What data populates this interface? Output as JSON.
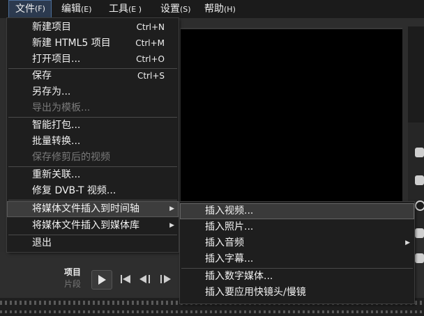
{
  "menubar": {
    "items": [
      {
        "label": "文件",
        "accel": "(F)"
      },
      {
        "label": "编辑",
        "accel": "(E)"
      },
      {
        "label": "工具",
        "accel": "(E )"
      },
      {
        "label": "设置",
        "accel": "(S)"
      },
      {
        "label": "帮助",
        "accel": "(H)"
      }
    ]
  },
  "file_menu": {
    "items": [
      {
        "label": "新建项目",
        "shortcut": "Ctrl+N"
      },
      {
        "label": "新建 HTML5 项目",
        "shortcut": "Ctrl+M"
      },
      {
        "label": "打开项目...",
        "shortcut": "Ctrl+O"
      },
      {
        "label": "保存",
        "shortcut": "Ctrl+S"
      },
      {
        "label": "另存为..."
      },
      {
        "label": "导出为模板...",
        "disabled": true
      },
      {
        "label": "智能打包..."
      },
      {
        "label": "批量转换..."
      },
      {
        "label": "保存修剪后的视频",
        "disabled": true
      },
      {
        "label": "重新关联..."
      },
      {
        "label": "修复 DVB-T 视频..."
      },
      {
        "label": "将媒体文件插入到时间轴",
        "highlighted": true
      },
      {
        "label": "将媒体文件插入到媒体库"
      },
      {
        "label": "退出"
      }
    ]
  },
  "submenu": {
    "items": [
      {
        "label": "插入视频...",
        "highlighted": true
      },
      {
        "label": "插入照片..."
      },
      {
        "label": "插入音频"
      },
      {
        "label": "插入字幕..."
      },
      {
        "label": "插入数字媒体..."
      },
      {
        "label": "插入要应用快镜头/慢镜"
      }
    ]
  },
  "player": {
    "project_label": "项目",
    "clip_label": "片段",
    "play_icon": "play-icon",
    "prev_icon": "skip-back-icon",
    "step_back_icon": "step-back-icon",
    "step_fwd_icon": "step-forward-icon"
  },
  "colors": {
    "menu_bg": "#1e1e1e",
    "menubar_bg": "#1b1b1b",
    "highlight": "#3d3d3d",
    "disabled_text": "#7a7a7a",
    "preview_bg": "#000000"
  }
}
